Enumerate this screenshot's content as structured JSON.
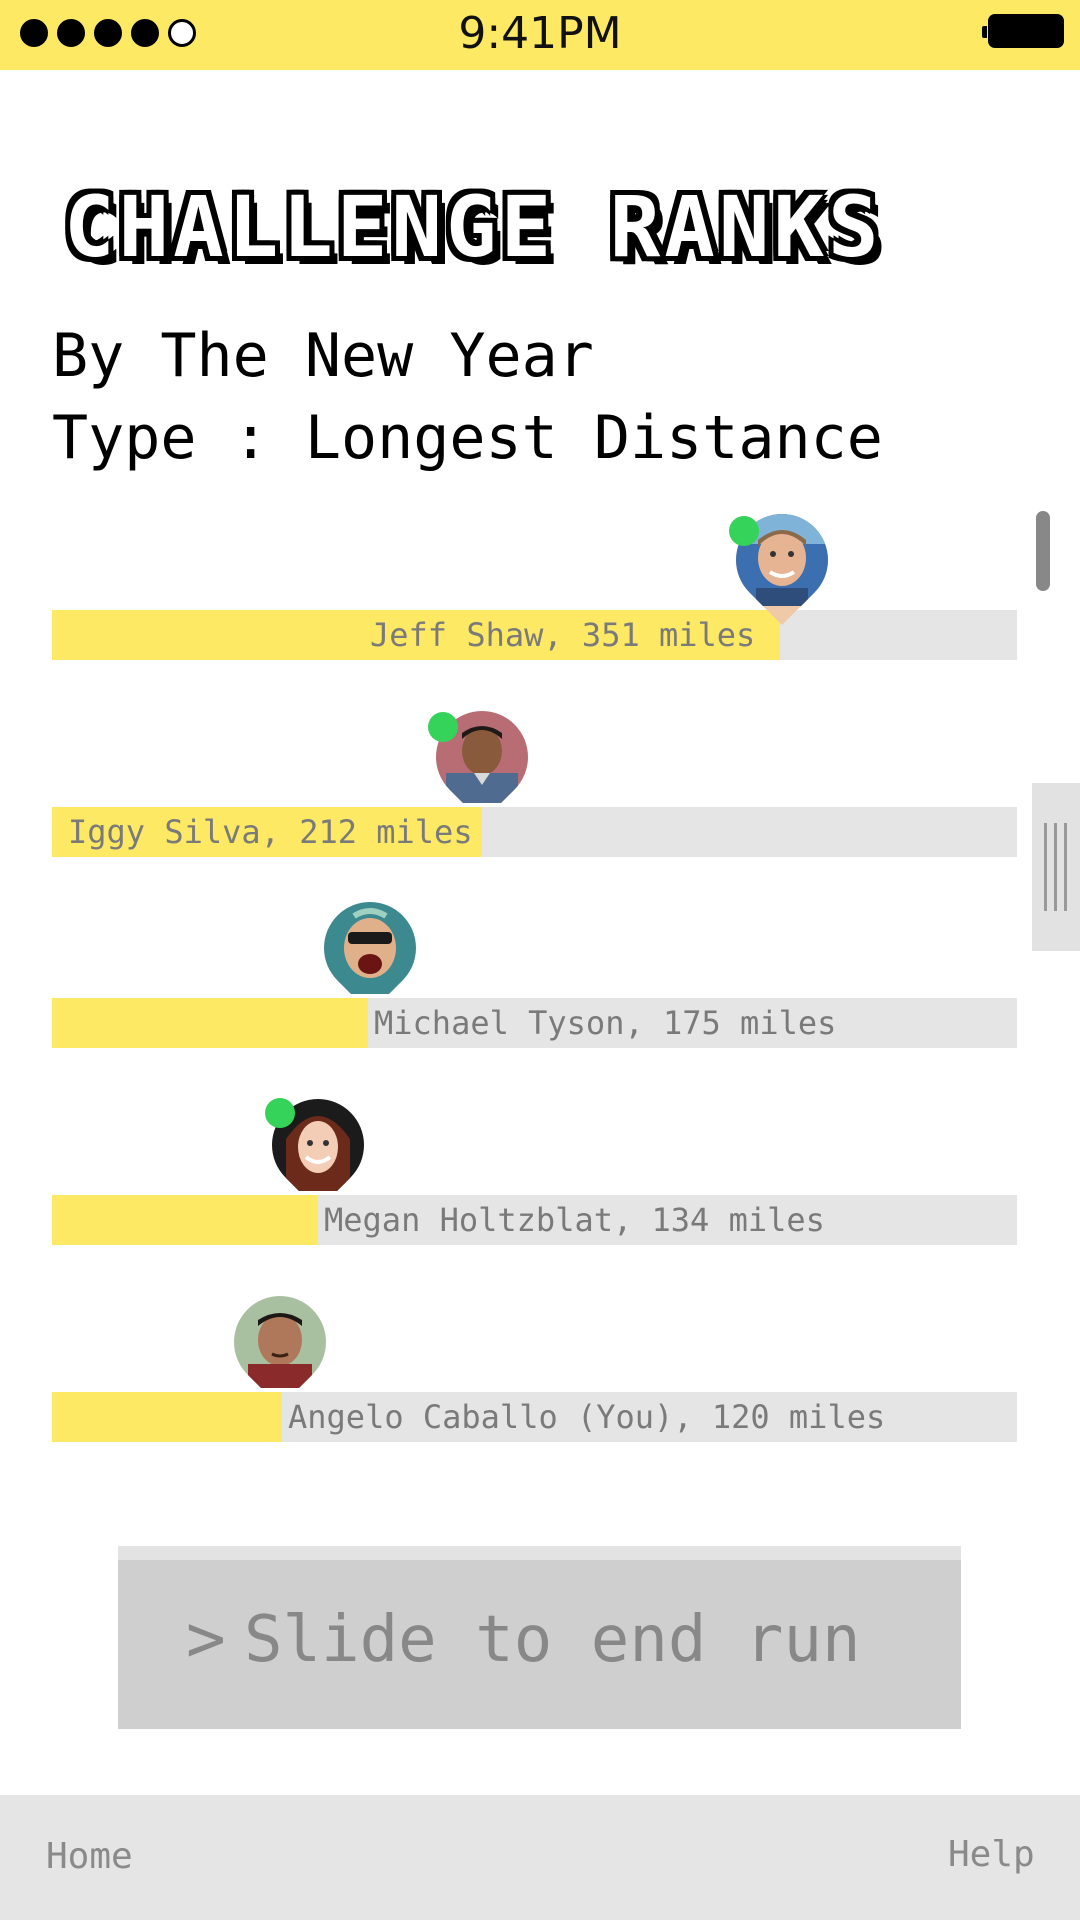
{
  "status_bar": {
    "time": "9:41PM",
    "signal_icon": "signal-dots-icon",
    "battery_icon": "battery-icon",
    "color": "#fde964"
  },
  "header": {
    "title": "CHALLENGE RANKS",
    "challenge_name": "By The New Year",
    "challenge_type": "Type : Longest Distance"
  },
  "ranks": [
    {
      "label": "Jeff Shaw, 351 miles",
      "progress": 0.755,
      "online": true,
      "avatar_icon": "avatar-jeff-shaw"
    },
    {
      "label": "Iggy Silva, 212 miles",
      "progress": 0.445,
      "online": true,
      "avatar_icon": "avatar-iggy-silva"
    },
    {
      "label": "Michael Tyson, 175 miles",
      "progress": 0.328,
      "online": false,
      "avatar_icon": "avatar-michael-tyson"
    },
    {
      "label": "Megan Holtzblat, 134 miles",
      "progress": 0.275,
      "online": true,
      "avatar_icon": "avatar-megan-holtzblat"
    },
    {
      "label": "Angelo Caballo (You), 120 miles",
      "progress": 0.24,
      "online": false,
      "avatar_icon": "avatar-angelo-caballo"
    }
  ],
  "slide": {
    "chevron": ">",
    "label": "Slide to end run"
  },
  "nav": {
    "home": "Home",
    "help": "Help"
  },
  "colors": {
    "accent": "#fde964",
    "track": "#e5e5e5",
    "online": "#35d35a"
  }
}
